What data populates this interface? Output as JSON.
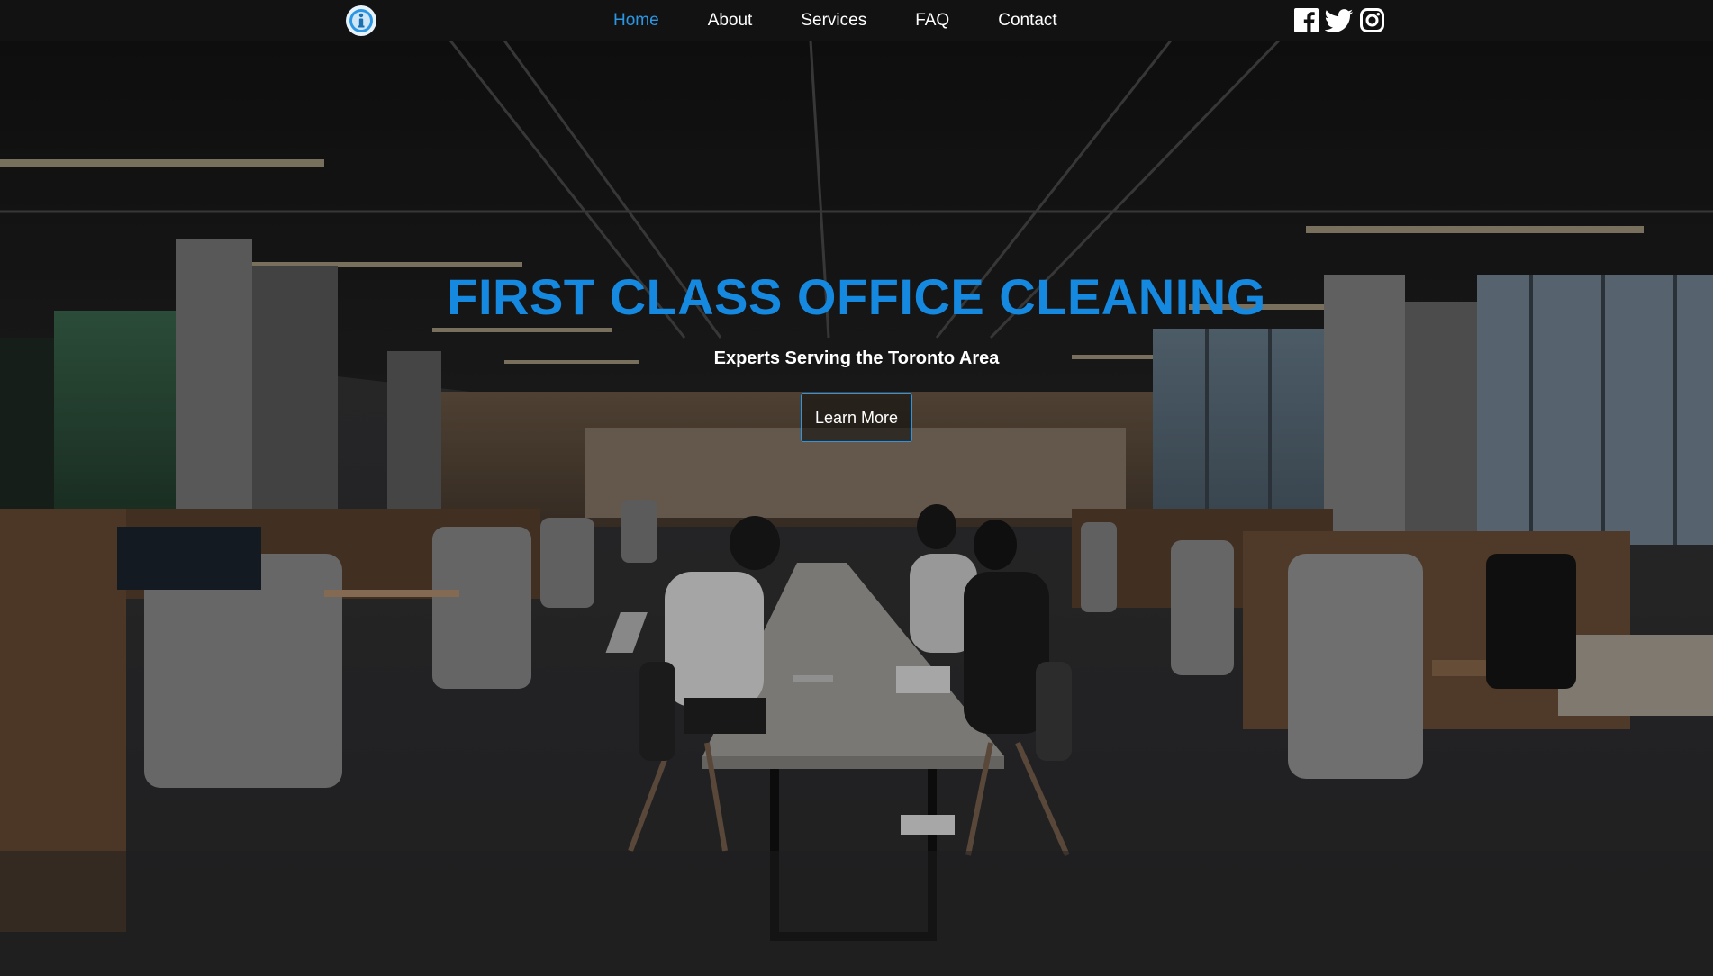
{
  "nav": {
    "logo_icon": "info-logo-icon",
    "links": [
      {
        "label": "Home",
        "active": true
      },
      {
        "label": "About",
        "active": false
      },
      {
        "label": "Services",
        "active": false
      },
      {
        "label": "FAQ",
        "active": false
      },
      {
        "label": "Contact",
        "active": false
      }
    ],
    "socials": [
      "facebook-icon",
      "twitter-icon",
      "instagram-icon"
    ]
  },
  "hero": {
    "title": "FIRST CLASS OFFICE CLEANING",
    "subtitle": "Experts Serving the Toronto Area",
    "cta_label": "Learn More",
    "background": "open-plan-office-photo"
  },
  "colors": {
    "accent": "#1589e0",
    "active_link": "#2b97e4",
    "navbar_bg": "#121212"
  }
}
